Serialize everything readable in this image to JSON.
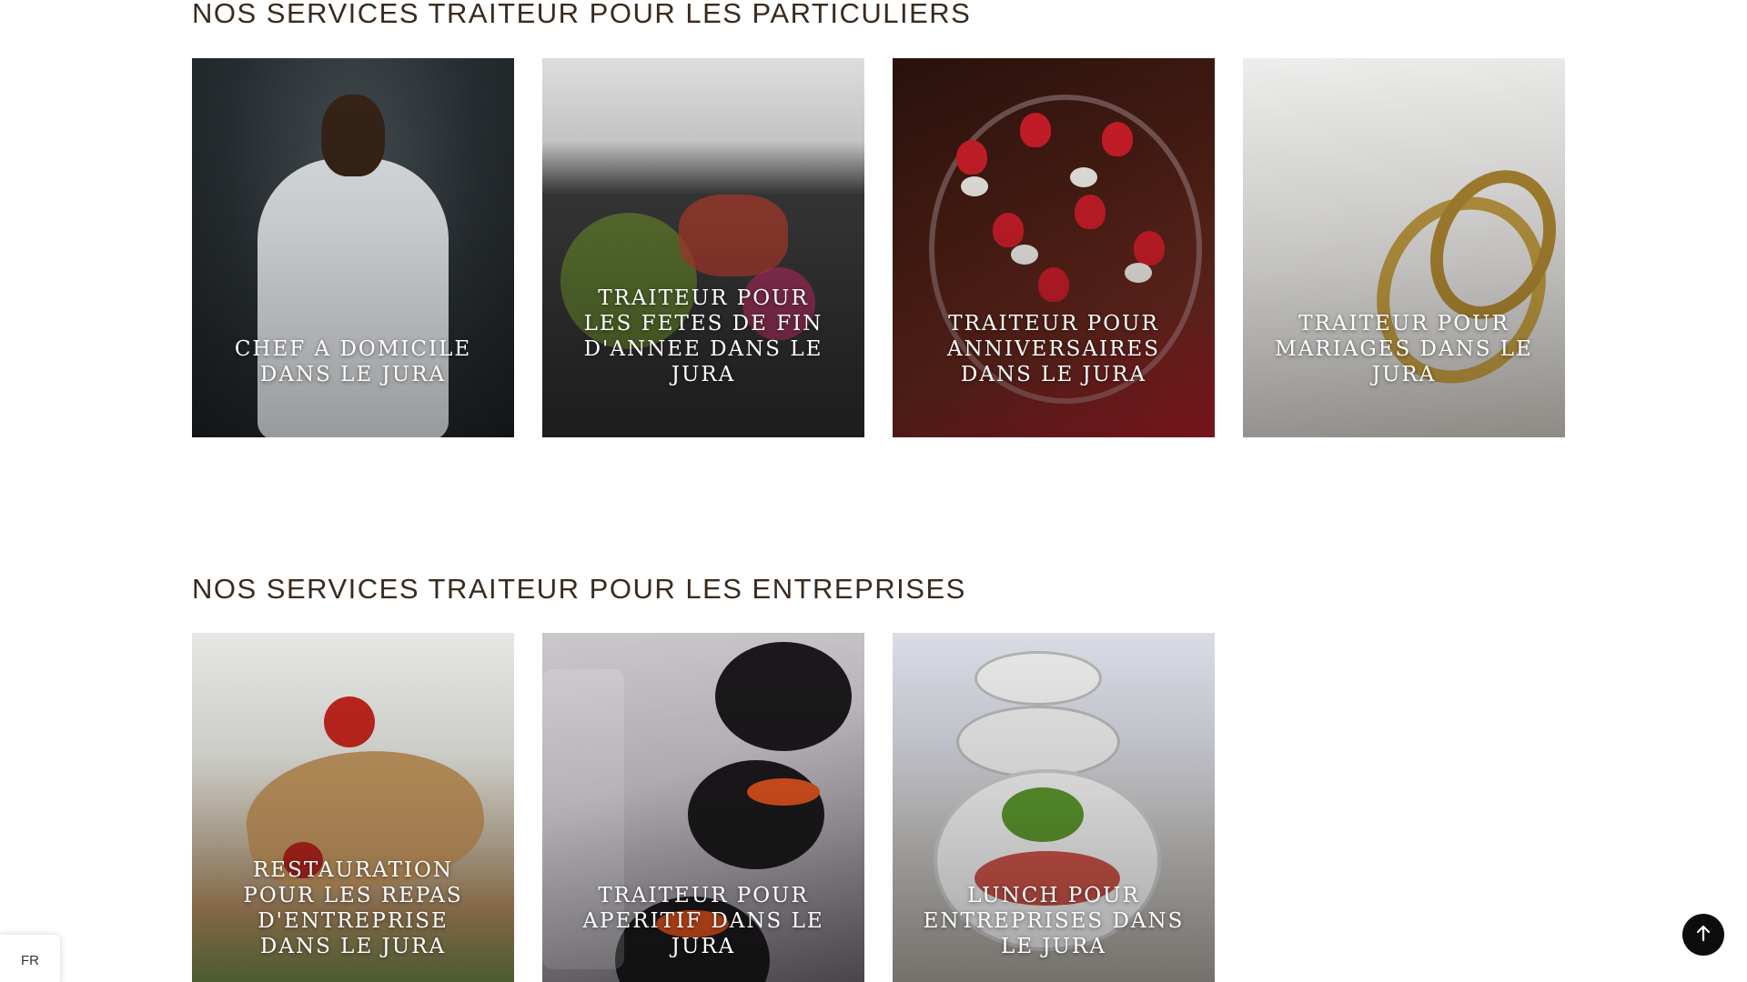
{
  "particuliers": {
    "title": "NOS SERVICES TRAITEUR POUR LES PARTICULIERS",
    "cards": [
      {
        "label": "CHEF A DOMICILE DANS LE JURA"
      },
      {
        "label": "TRAITEUR POUR LES FETES DE FIN D'ANNEE DANS LE JURA"
      },
      {
        "label": "TRAITEUR POUR ANNIVERSAIRES DANS LE JURA"
      },
      {
        "label": "TRAITEUR POUR MARIAGES DANS LE JURA"
      }
    ]
  },
  "entreprises": {
    "title": "NOS SERVICES TRAITEUR POUR LES ENTREPRISES",
    "cards": [
      {
        "label": "RESTAURATION POUR LES REPAS D'ENTREPRISE DANS LE JURA"
      },
      {
        "label": "TRAITEUR POUR APERITIF DANS LE JURA"
      },
      {
        "label": "LUNCH POUR ENTREPRISES DANS LE JURA"
      }
    ]
  },
  "language_switcher": {
    "label": "FR"
  },
  "icons": {
    "scroll_top": "arrow-up-icon"
  },
  "colors": {
    "title": "#3a2a1e",
    "scroll_button": "#0d0d0d"
  }
}
